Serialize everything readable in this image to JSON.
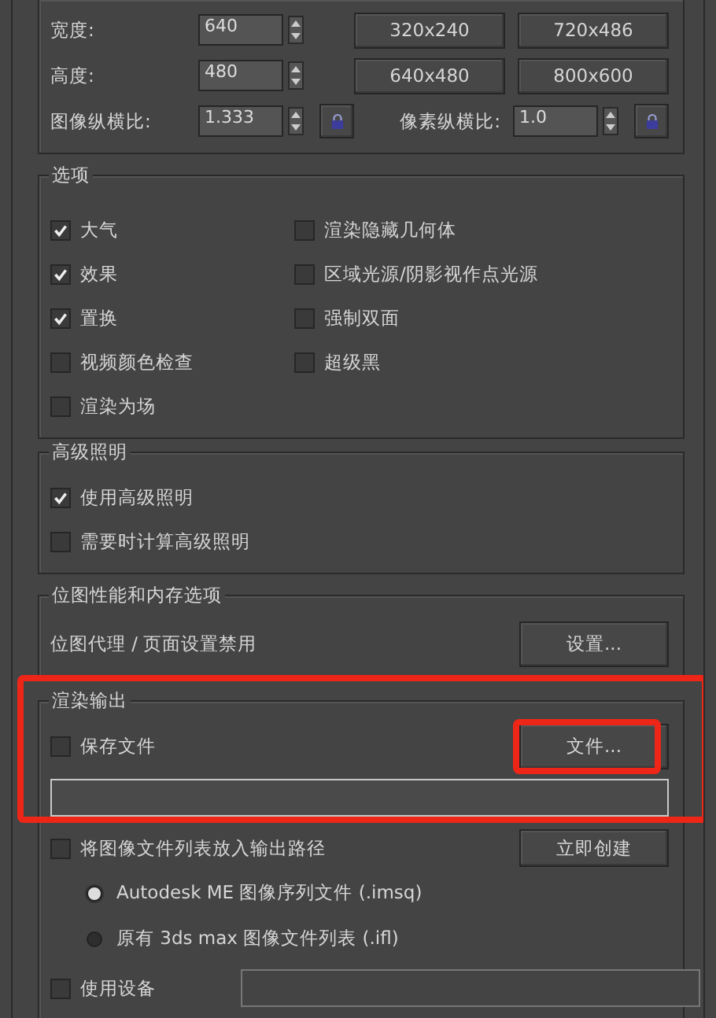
{
  "resolution": {
    "fields": [
      {
        "label": "宽度:",
        "value": "640"
      },
      {
        "label": "高度:",
        "value": "480"
      }
    ],
    "presets": [
      "320x240",
      "720x486",
      "640x480",
      "800x600"
    ],
    "image_aspect": {
      "label": "图像纵横比:",
      "value": "1.333"
    },
    "pixel_aspect": {
      "label": "像素纵横比:",
      "value": "1.0"
    }
  },
  "options": {
    "title": "选项",
    "columns": [
      [
        {
          "label": "大气",
          "checked": true
        },
        {
          "label": "效果",
          "checked": true
        },
        {
          "label": "置换",
          "checked": true
        },
        {
          "label": "视频颜色检查",
          "checked": false
        },
        {
          "label": "渲染为场",
          "checked": false
        }
      ],
      [
        {
          "label": "渲染隐藏几何体",
          "checked": false
        },
        {
          "label": "区域光源/阴影视作点光源",
          "checked": false
        },
        {
          "label": "强制双面",
          "checked": false
        },
        {
          "label": "超级黑",
          "checked": false
        }
      ]
    ]
  },
  "advanced_lighting": {
    "title": "高级照明",
    "items": [
      {
        "label": "使用高级照明",
        "checked": true
      },
      {
        "label": "需要时计算高级照明",
        "checked": false
      }
    ]
  },
  "bitmap": {
    "title": "位图性能和内存选项",
    "status": "位图代理 / 页面设置禁用",
    "button": "设置..."
  },
  "render_output": {
    "title": "渲染输出",
    "highlighted": true,
    "save_file": {
      "label": "保存文件",
      "checked": false
    },
    "file_button": {
      "label": "文件...",
      "highlighted": true
    },
    "put_list": {
      "label": "将图像文件列表放入输出路径",
      "checked": false
    },
    "create_button": "立即创建",
    "formats": [
      {
        "label": "Autodesk ME 图像序列文件 (.imsq)",
        "selected": true
      },
      {
        "label": "原有 3ds max 图像文件列表 (.ifl)",
        "selected": false
      }
    ],
    "use_device": {
      "label": "使用设备",
      "checked": false
    }
  }
}
